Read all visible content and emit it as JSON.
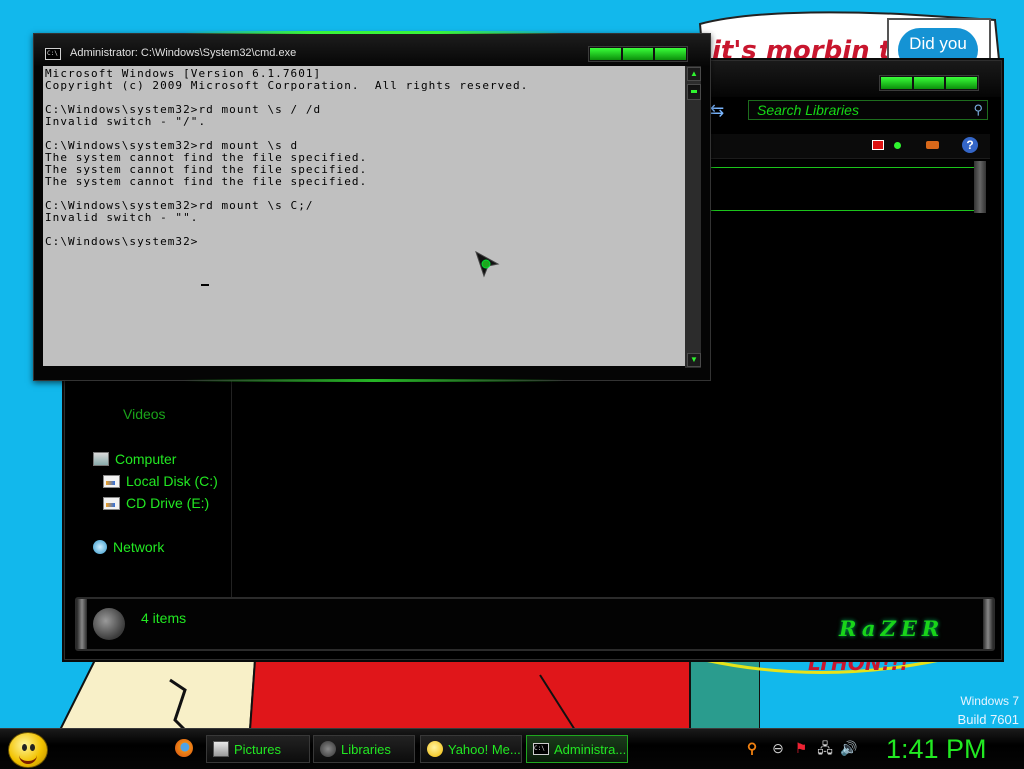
{
  "wallpaper": {
    "banner_top": "it's morbin t",
    "badge_text": "Did you",
    "banner_bottom": "LTHON!!!"
  },
  "watermark": {
    "line1": "Windows 7",
    "line2": "Build 7601"
  },
  "explorer": {
    "search_placeholder": "Search Libraries",
    "nav": {
      "videos": "Videos",
      "computer": "Computer",
      "local_disk": "Local Disk (C:)",
      "cd_drive": "CD Drive (E:)",
      "network": "Network"
    },
    "details": {
      "item_count": "4 items",
      "brand_logo": "RaZER"
    }
  },
  "cmd": {
    "title": "Administrator: C:\\Windows\\System32\\cmd.exe",
    "output": "Microsoft Windows [Version 6.1.7601]\nCopyright (c) 2009 Microsoft Corporation.  All rights reserved.\n\nC:\\Windows\\system32>rd mount \\s / /d\nInvalid switch - \"/\".\n\nC:\\Windows\\system32>rd mount \\s d\nThe system cannot find the file specified.\nThe system cannot find the file specified.\nThe system cannot find the file specified.\n\nC:\\Windows\\system32>rd mount \\s C;/\nInvalid switch - \"\".\n\nC:\\Windows\\system32>"
  },
  "taskbar": {
    "buttons": [
      {
        "label": "Pictures"
      },
      {
        "label": "Libraries"
      },
      {
        "label": "Yahoo! Me..."
      },
      {
        "label": "Administra...",
        "active": true
      }
    ],
    "clock": "1:41 PM"
  },
  "colors": {
    "accent_green": "#22e822",
    "desktop_blue": "#12b8ec",
    "console_bg": "#c0c0c0"
  }
}
